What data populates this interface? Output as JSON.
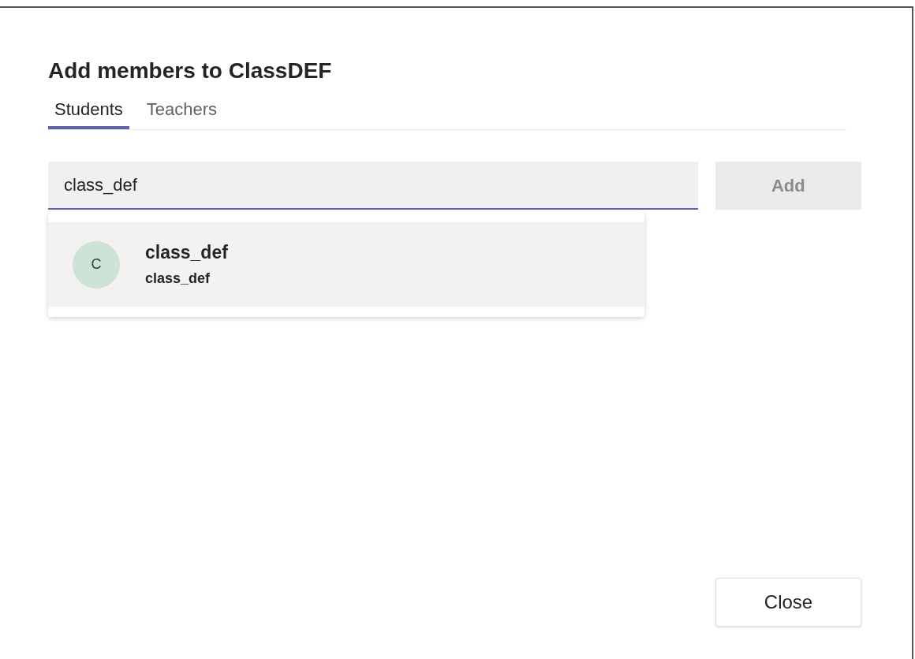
{
  "dialog": {
    "title": "Add members to ClassDEF"
  },
  "tabs": [
    {
      "label": "Students",
      "selected": true
    },
    {
      "label": "Teachers",
      "selected": false
    }
  ],
  "search": {
    "value": "class_def"
  },
  "add_button": {
    "label": "Add",
    "disabled": true
  },
  "suggestions": [
    {
      "initial": "C",
      "name": "class_def",
      "subtitle": "class_def",
      "selected": true
    }
  ],
  "close_button": {
    "label": "Close"
  }
}
